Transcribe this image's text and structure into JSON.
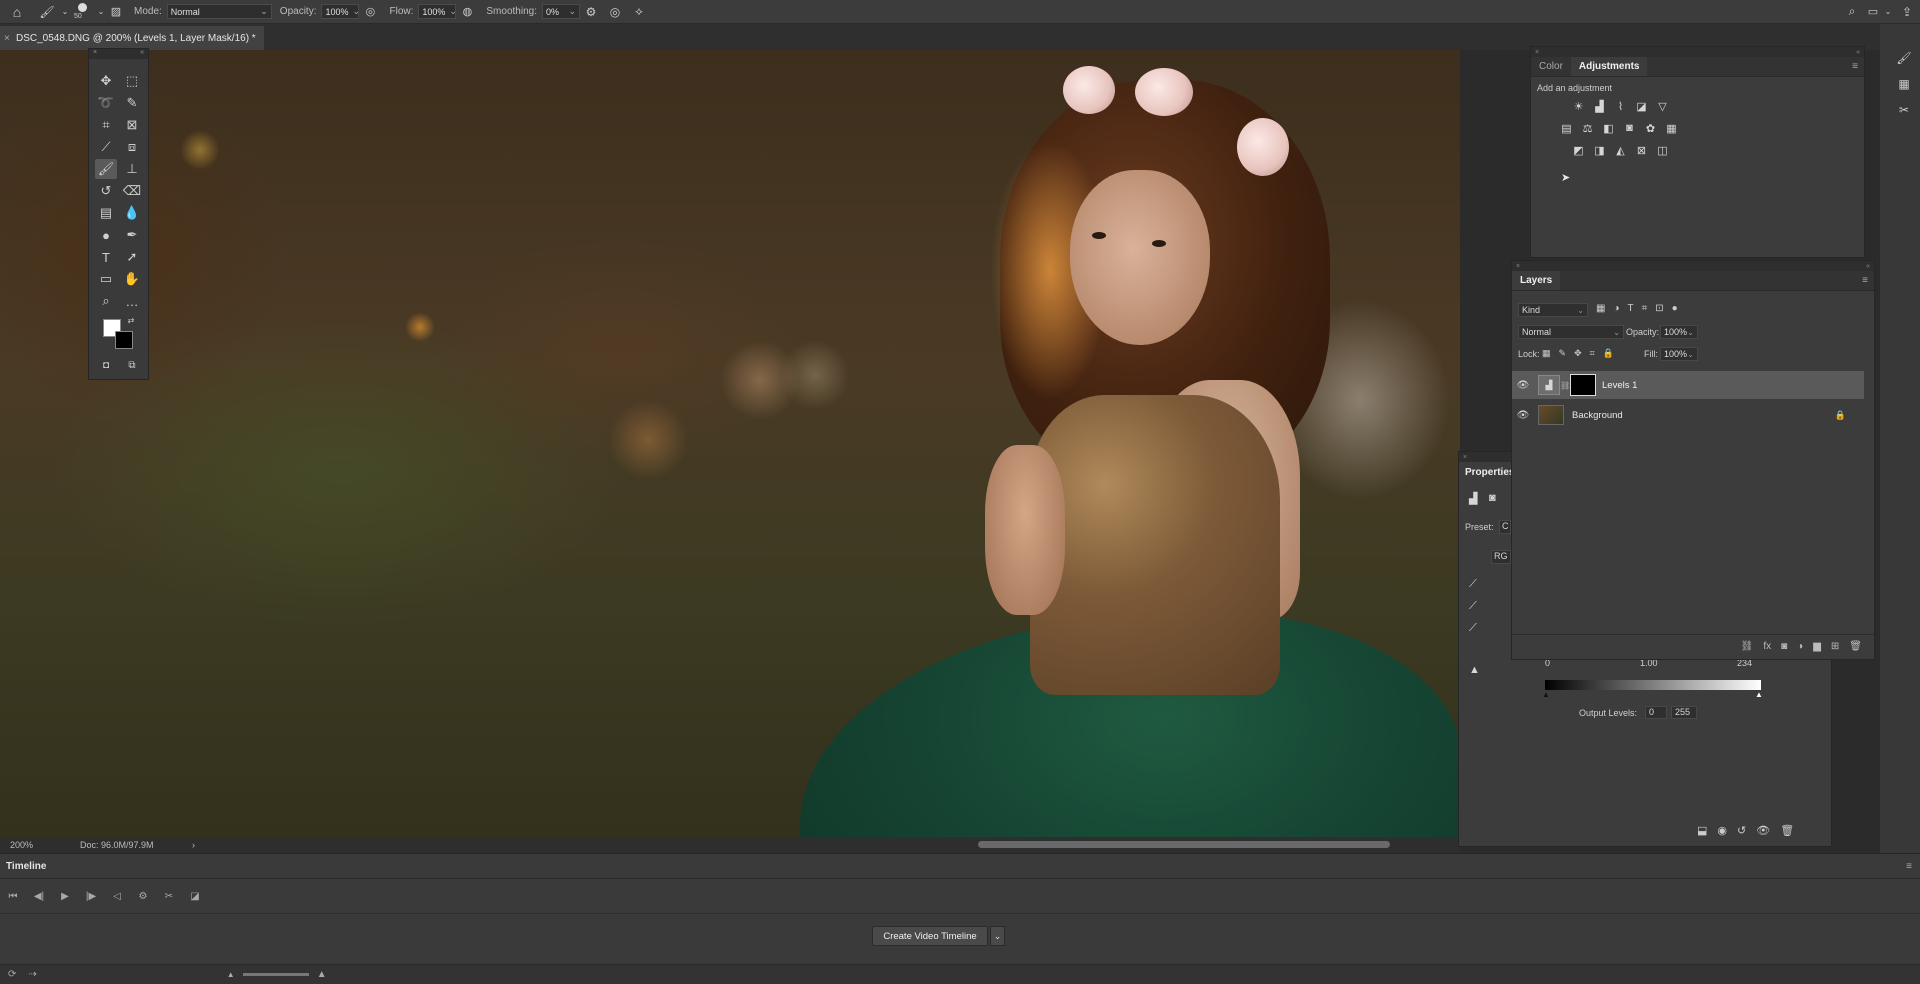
{
  "options_bar": {
    "brush_size": "50",
    "mode_label": "Mode:",
    "mode_value": "Normal",
    "opacity_label": "Opacity:",
    "opacity_value": "100%",
    "flow_label": "Flow:",
    "flow_value": "100%",
    "smoothing_label": "Smoothing:",
    "smoothing_value": "0%"
  },
  "document": {
    "tab_title": "DSC_0548.DNG @ 200% (Levels 1, Layer Mask/16) *"
  },
  "status_bar": {
    "zoom": "200%",
    "doc_size": "Doc: 96.0M/97.9M",
    "arrow": "›"
  },
  "adjustments_panel": {
    "tabs": [
      {
        "label": "Color"
      },
      {
        "label": "Adjustments"
      }
    ],
    "subtitle": "Add an adjustment"
  },
  "layers_panel": {
    "title": "Layers",
    "filter_kind": "Kind",
    "blend_mode": "Normal",
    "opacity_label": "Opacity:",
    "opacity_value": "100%",
    "lock_label": "Lock:",
    "fill_label": "Fill:",
    "fill_value": "100%",
    "layers": [
      {
        "name": "Levels 1",
        "selected": true
      },
      {
        "name": "Background",
        "locked": true
      }
    ]
  },
  "properties_panel": {
    "title": "Properties",
    "preset_label": "Preset:",
    "preset_value": "C",
    "channel_value": "RG",
    "input_values": [
      "0",
      "1.00",
      "234"
    ],
    "output_label": "Output Levels:",
    "output_values": [
      "0",
      "255"
    ]
  },
  "timeline": {
    "title": "Timeline",
    "create_button": "Create Video Timeline"
  },
  "colors": {
    "ui_bg": "#3c3c3c",
    "panel_dark": "#2e2e2e",
    "selection": "#5a5a5a"
  }
}
